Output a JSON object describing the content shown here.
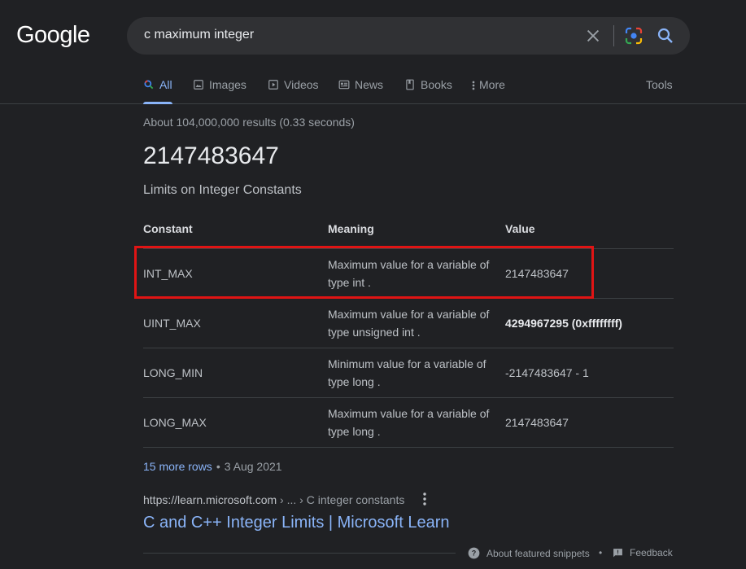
{
  "logo": "Google",
  "search": {
    "query": "c maximum integer"
  },
  "tabs": [
    {
      "label": "All",
      "icon": "search-icon"
    },
    {
      "label": "Images",
      "icon": "image-icon"
    },
    {
      "label": "Videos",
      "icon": "play-icon"
    },
    {
      "label": "News",
      "icon": "news-icon"
    },
    {
      "label": "Books",
      "icon": "book-icon"
    },
    {
      "label": "More",
      "icon": "more-vert-icon"
    }
  ],
  "tools_label": "Tools",
  "stats": "About 104,000,000 results (0.33 seconds)",
  "answer": "2147483647",
  "subtitle": "Limits on Integer Constants",
  "table": {
    "headers": [
      "Constant",
      "Meaning",
      "Value"
    ],
    "rows": [
      {
        "constant": "INT_MAX",
        "meaning": "Maximum value for a variable of type int .",
        "value": "2147483647"
      },
      {
        "constant": "UINT_MAX",
        "meaning": "Maximum value for a variable of type unsigned int .",
        "value": "4294967295 (0xffffffff)"
      },
      {
        "constant": "LONG_MIN",
        "meaning": "Minimum value for a variable of type long .",
        "value": "-2147483647 - 1"
      },
      {
        "constant": "LONG_MAX",
        "meaning": "Maximum value for a variable of type long .",
        "value": "2147483647"
      }
    ]
  },
  "more_rows": "15 more rows",
  "date": "3 Aug 2021",
  "source": {
    "url": "https://learn.microsoft.com",
    "crumbs": " › ... › C integer constants",
    "title": "C and C++ Integer Limits | Microsoft Learn"
  },
  "footer": {
    "about": "About featured snippets",
    "feedback": "Feedback"
  },
  "colors": {
    "background": "#202124",
    "link": "#8ab4f8",
    "highlight": "#e01414"
  }
}
